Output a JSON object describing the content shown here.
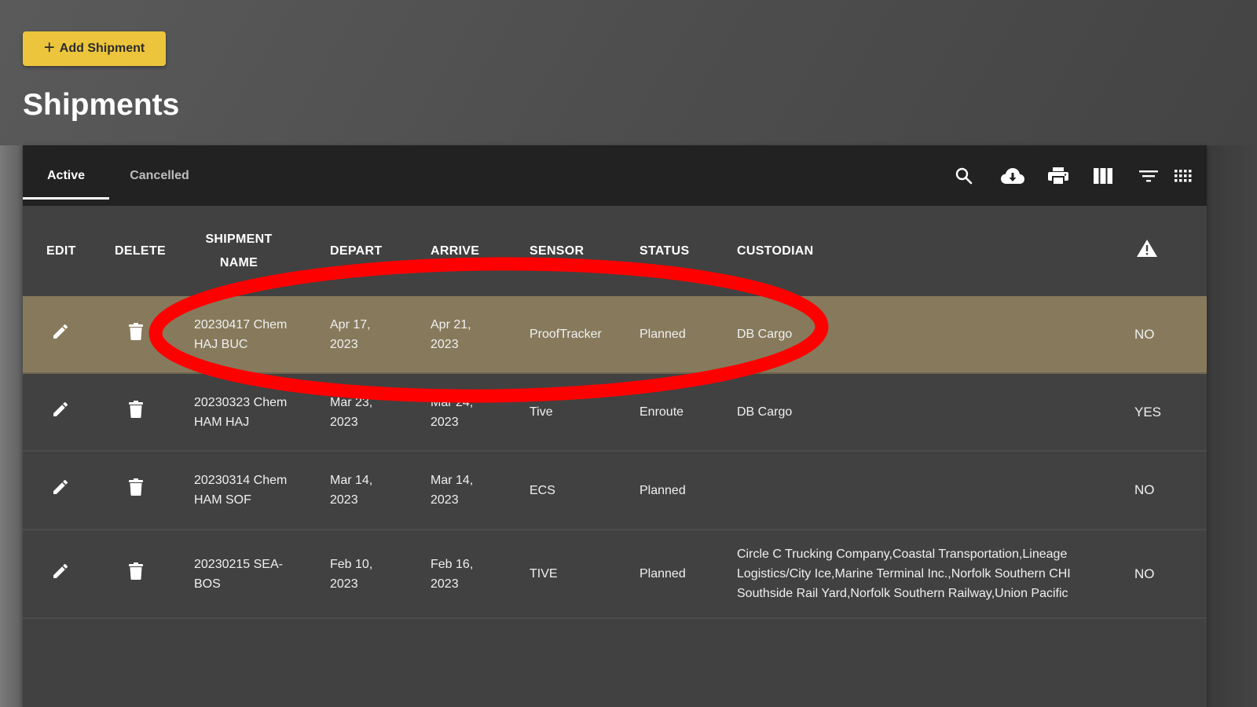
{
  "actions": {
    "add_shipment_label": "Add Shipment",
    "add_icon": "plus-icon"
  },
  "page": {
    "title": "Shipments"
  },
  "tabs": [
    {
      "label": "Active",
      "active": true
    },
    {
      "label": "Cancelled",
      "active": false
    }
  ],
  "toolbar_icons": [
    "search-icon",
    "cloud-download-icon",
    "print-icon",
    "columns-icon",
    "filter-icon",
    "density-grid-icon"
  ],
  "table": {
    "headers": {
      "edit": "EDIT",
      "delete": "DELETE",
      "shipment_name_line1": "SHIPMENT",
      "shipment_name_line2": "NAME",
      "depart": "DEPART",
      "arrive": "ARRIVE",
      "sensor": "SENSOR",
      "status": "STATUS",
      "custodian": "CUSTODIAN",
      "alert_icon": "warning-icon"
    },
    "rows": [
      {
        "name_line1": "20230417 Chem",
        "name_line2": "HAJ BUC",
        "depart_line1": "Apr 17,",
        "depart_line2": "2023",
        "arrive_line1": "Apr 21,",
        "arrive_line2": "2023",
        "sensor": "ProofTracker",
        "status": "Planned",
        "custodian": "DB Cargo",
        "alert": "NO",
        "highlighted": true
      },
      {
        "name_line1": "20230323 Chem",
        "name_line2": "HAM HAJ",
        "depart_line1": "Mar 23,",
        "depart_line2": "2023",
        "arrive_line1": "Mar 24,",
        "arrive_line2": "2023",
        "sensor": "Tive",
        "status": "Enroute",
        "custodian": "DB Cargo",
        "alert": "YES",
        "highlighted": false
      },
      {
        "name_line1": "20230314 Chem",
        "name_line2": "HAM SOF",
        "depart_line1": "Mar 14,",
        "depart_line2": "2023",
        "arrive_line1": "Mar 14,",
        "arrive_line2": "2023",
        "sensor": "ECS",
        "status": "Planned",
        "custodian": "",
        "alert": "NO",
        "highlighted": false
      },
      {
        "name_line1": "20230215 SEA-",
        "name_line2": "BOS",
        "depart_line1": "Feb 10,",
        "depart_line2": "2023",
        "arrive_line1": "Feb 16,",
        "arrive_line2": "2023",
        "sensor": "TIVE",
        "status": "Planned",
        "custodian": "Circle C Trucking Company,Coastal Transportation,Lineage Logistics/City Ice,Marine Terminal Inc.,Norfolk Southern CHI Southside Rail Yard,Norfolk Southern Railway,Union Pacific",
        "alert": "NO",
        "highlighted": false
      }
    ]
  },
  "annotation": {
    "type": "red-ellipse",
    "target": "row 1 (20230417 Chem HAJ BUC)",
    "color": "#ff0000"
  },
  "colors": {
    "accent": "#ecc53c",
    "toolbar_bg": "#222222",
    "panel_bg": "#414141",
    "highlight_row": "#877a5c",
    "annotation": "#ff0000"
  }
}
